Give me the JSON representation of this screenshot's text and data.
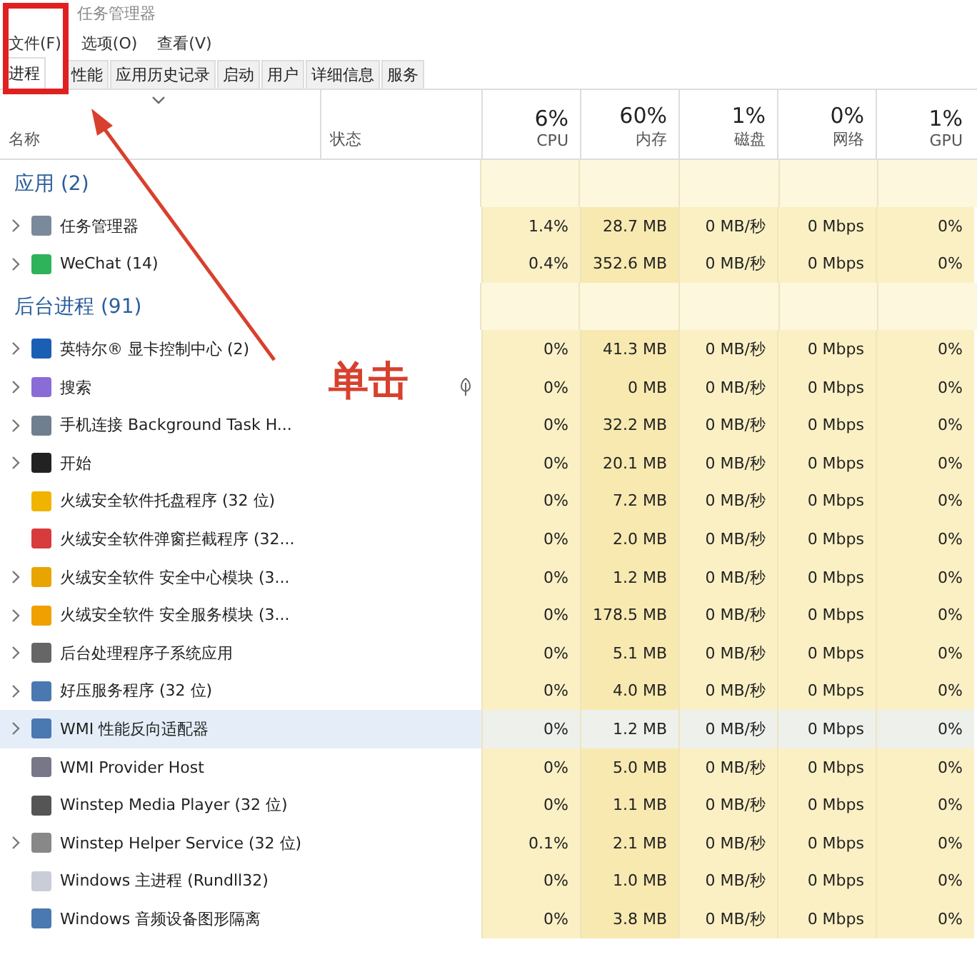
{
  "window": {
    "title": "任务管理器"
  },
  "menu": [
    "文件(F)",
    "选项(O)",
    "查看(V)"
  ],
  "tabs": [
    {
      "label": "进程",
      "selected": true
    },
    {
      "label": "性能",
      "selected": false
    },
    {
      "label": "应用历史记录",
      "selected": false
    },
    {
      "label": "启动",
      "selected": false
    },
    {
      "label": "用户",
      "selected": false
    },
    {
      "label": "详细信息",
      "selected": false
    },
    {
      "label": "服务",
      "selected": false
    }
  ],
  "columns": {
    "name": "名称",
    "status": "状态",
    "metrics": [
      {
        "percent": "6%",
        "label": "CPU"
      },
      {
        "percent": "60%",
        "label": "内存"
      },
      {
        "percent": "1%",
        "label": "磁盘"
      },
      {
        "percent": "0%",
        "label": "网络"
      },
      {
        "percent": "1%",
        "label": "GPU"
      }
    ]
  },
  "groups": [
    {
      "title": "应用 (2)",
      "rows": [
        {
          "name": "任务管理器",
          "expandable": true,
          "selected": false,
          "suspended": false,
          "values": [
            "1.4%",
            "28.7 MB",
            "0 MB/秒",
            "0 Mbps",
            "0%"
          ]
        },
        {
          "name": "WeChat (14)",
          "expandable": true,
          "selected": false,
          "suspended": false,
          "values": [
            "0.4%",
            "352.6 MB",
            "0 MB/秒",
            "0 Mbps",
            "0%"
          ]
        }
      ]
    },
    {
      "title": "后台进程 (91)",
      "rows": [
        {
          "name": "英特尔® 显卡控制中心 (2)",
          "expandable": true,
          "selected": false,
          "suspended": false,
          "values": [
            "0%",
            "41.3 MB",
            "0 MB/秒",
            "0 Mbps",
            "0%"
          ]
        },
        {
          "name": "搜索",
          "expandable": true,
          "selected": false,
          "suspended": true,
          "values": [
            "0%",
            "0 MB",
            "0 MB/秒",
            "0 Mbps",
            "0%"
          ]
        },
        {
          "name": "手机连接 Background Task H...",
          "expandable": true,
          "selected": false,
          "suspended": false,
          "values": [
            "0%",
            "32.2 MB",
            "0 MB/秒",
            "0 Mbps",
            "0%"
          ]
        },
        {
          "name": "开始",
          "expandable": true,
          "selected": false,
          "suspended": false,
          "values": [
            "0%",
            "20.1 MB",
            "0 MB/秒",
            "0 Mbps",
            "0%"
          ]
        },
        {
          "name": "火绒安全软件托盘程序 (32 位)",
          "expandable": false,
          "selected": false,
          "suspended": false,
          "values": [
            "0%",
            "7.2 MB",
            "0 MB/秒",
            "0 Mbps",
            "0%"
          ]
        },
        {
          "name": "火绒安全软件弹窗拦截程序 (32...",
          "expandable": false,
          "selected": false,
          "suspended": false,
          "values": [
            "0%",
            "2.0 MB",
            "0 MB/秒",
            "0 Mbps",
            "0%"
          ]
        },
        {
          "name": "火绒安全软件 安全中心模块 (3...",
          "expandable": true,
          "selected": false,
          "suspended": false,
          "values": [
            "0%",
            "1.2 MB",
            "0 MB/秒",
            "0 Mbps",
            "0%"
          ]
        },
        {
          "name": "火绒安全软件 安全服务模块 (3...",
          "expandable": true,
          "selected": false,
          "suspended": false,
          "values": [
            "0%",
            "178.5 MB",
            "0 MB/秒",
            "0 Mbps",
            "0%"
          ]
        },
        {
          "name": "后台处理程序子系统应用",
          "expandable": true,
          "selected": false,
          "suspended": false,
          "values": [
            "0%",
            "5.1 MB",
            "0 MB/秒",
            "0 Mbps",
            "0%"
          ]
        },
        {
          "name": "好压服务程序 (32 位)",
          "expandable": true,
          "selected": false,
          "suspended": false,
          "values": [
            "0%",
            "4.0 MB",
            "0 MB/秒",
            "0 Mbps",
            "0%"
          ]
        },
        {
          "name": "WMI 性能反向适配器",
          "expandable": true,
          "selected": true,
          "suspended": false,
          "values": [
            "0%",
            "1.2 MB",
            "0 MB/秒",
            "0 Mbps",
            "0%"
          ]
        },
        {
          "name": "WMI Provider Host",
          "expandable": false,
          "selected": false,
          "suspended": false,
          "values": [
            "0%",
            "5.0 MB",
            "0 MB/秒",
            "0 Mbps",
            "0%"
          ]
        },
        {
          "name": "Winstep Media Player (32 位)",
          "expandable": false,
          "selected": false,
          "suspended": false,
          "values": [
            "0%",
            "1.1 MB",
            "0 MB/秒",
            "0 Mbps",
            "0%"
          ]
        },
        {
          "name": "Winstep Helper Service (32 位)",
          "expandable": true,
          "selected": false,
          "suspended": false,
          "values": [
            "0.1%",
            "2.1 MB",
            "0 MB/秒",
            "0 Mbps",
            "0%"
          ]
        },
        {
          "name": "Windows 主进程 (Rundll32)",
          "expandable": false,
          "selected": false,
          "suspended": false,
          "values": [
            "0%",
            "1.0 MB",
            "0 MB/秒",
            "0 Mbps",
            "0%"
          ]
        },
        {
          "name": "Windows 音频设备图形隔离",
          "expandable": false,
          "selected": false,
          "suspended": false,
          "values": [
            "0%",
            "3.8 MB",
            "0 MB/秒",
            "0 Mbps",
            "0%"
          ]
        }
      ]
    }
  ],
  "annotation": {
    "label": "单击"
  }
}
